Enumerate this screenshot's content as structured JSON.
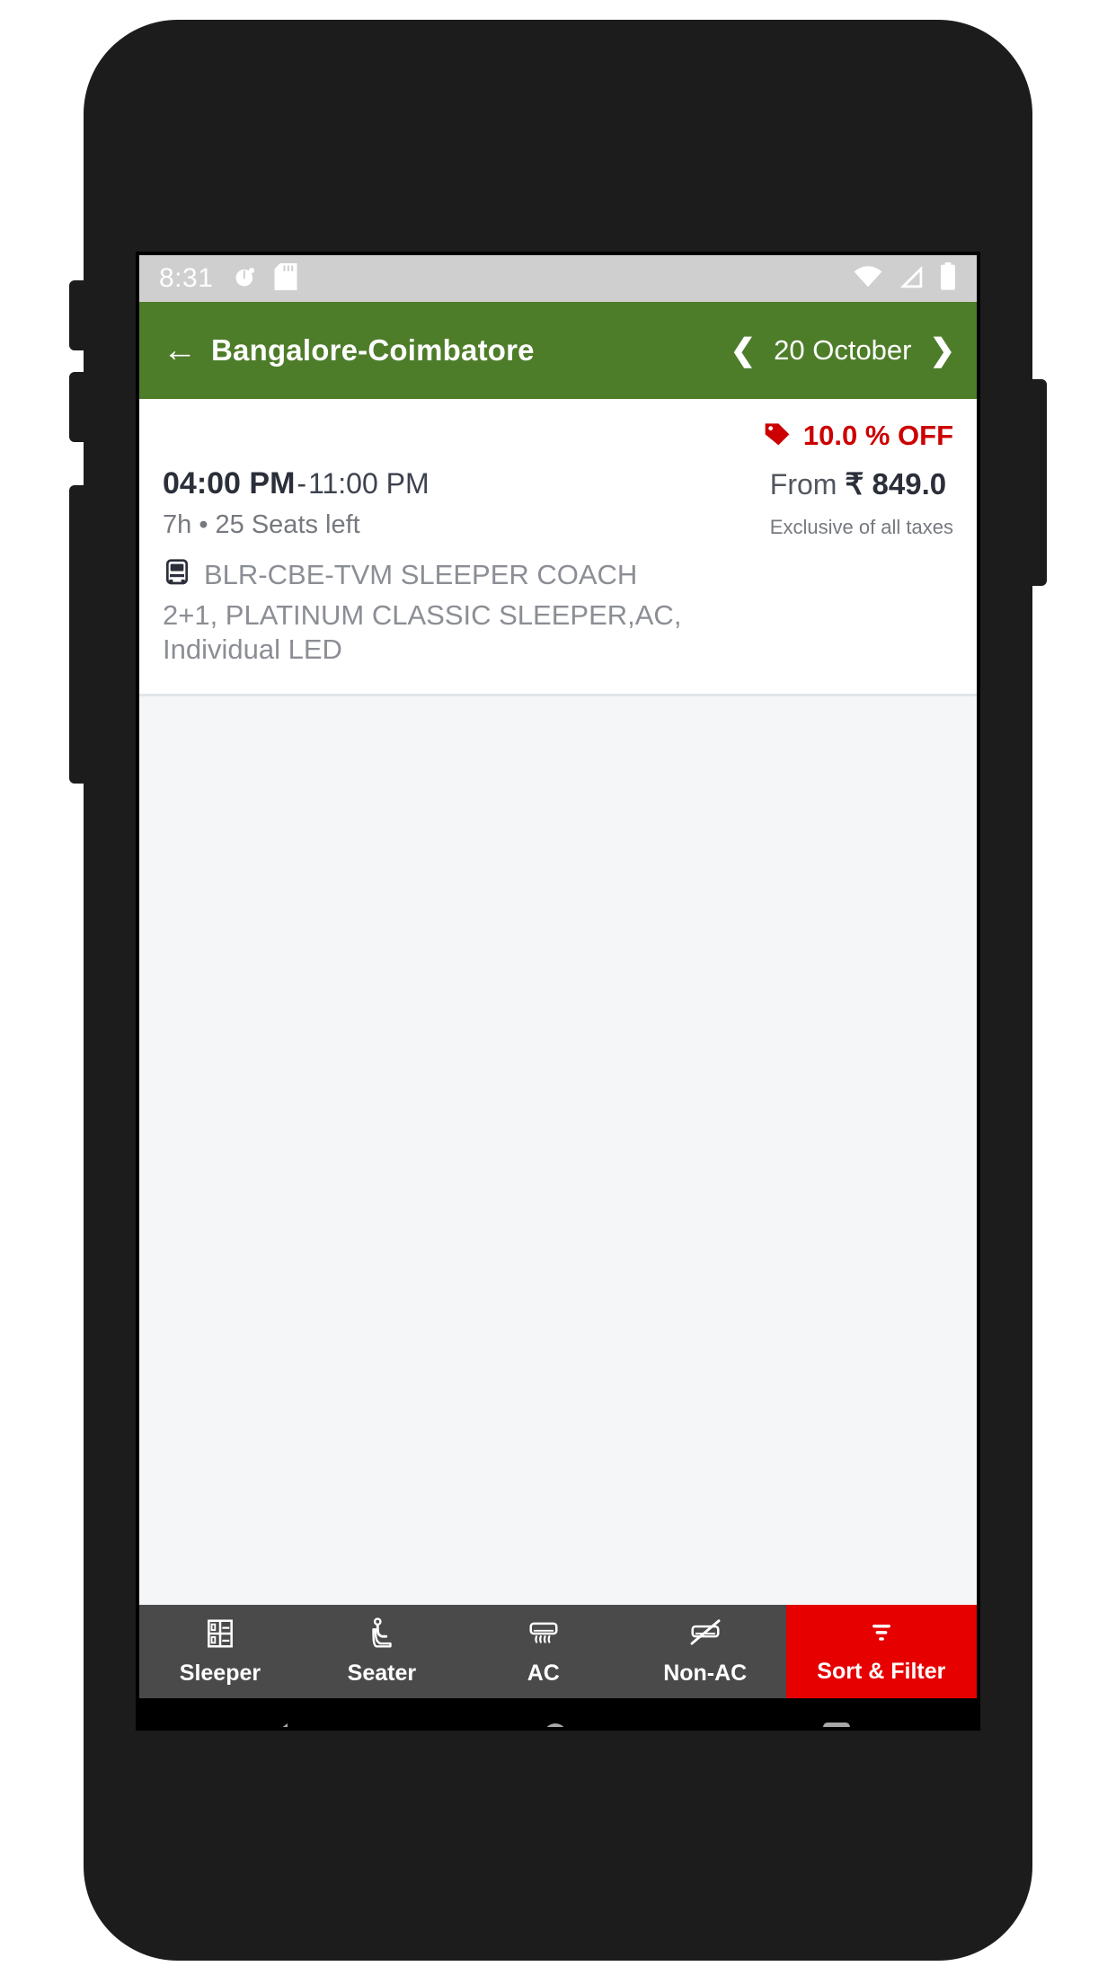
{
  "status_bar": {
    "clock": "8:31",
    "left_icons": [
      "alarm-icon",
      "sd-card-icon"
    ],
    "right_icons": [
      "wifi-icon",
      "cellular-signal-icon",
      "battery-icon"
    ],
    "background_color": "#cfcfcf"
  },
  "app_bar": {
    "back_icon": "back-arrow-icon",
    "route_title": "Bangalore-Coimbatore",
    "prev_day_icon": "chevron-left-icon",
    "selected_date": "20 October",
    "next_day_icon": "chevron-right-icon",
    "background_color": "#4e7d2a"
  },
  "bus_card": {
    "offer": {
      "icon": "price-tag-icon",
      "label": "10.0 % OFF",
      "color": "#cc0000"
    },
    "departure_time": "04:00 PM",
    "time_separator": "-",
    "arrival_time": "11:00 PM",
    "duration_seats": "7h  •  25 Seats left",
    "price_prefix": "From",
    "currency": "₹",
    "price": "849.0",
    "tax_note": "Exclusive of all taxes",
    "bus_icon": "bus-icon",
    "operator_name": "BLR-CBE-TVM SLEEPER COACH",
    "amenities": "2+1, PLATINUM CLASSIC SLEEPER,AC, Individual LED"
  },
  "filter_bar": {
    "items": [
      {
        "label": "Sleeper",
        "icon": "sleeper-berth-icon"
      },
      {
        "label": "Seater",
        "icon": "seat-icon"
      },
      {
        "label": "AC",
        "icon": "air-conditioner-icon"
      },
      {
        "label": "Non-AC",
        "icon": "air-conditioner-off-icon"
      },
      {
        "label": "Sort & Filter",
        "icon": "filter-funnel-icon"
      }
    ],
    "background_color": "#4a4a4a",
    "sort_color": "#e60000"
  },
  "nav_bar": {
    "back": "nav-back-icon",
    "home": "nav-home-icon",
    "recents": "nav-recents-icon"
  }
}
